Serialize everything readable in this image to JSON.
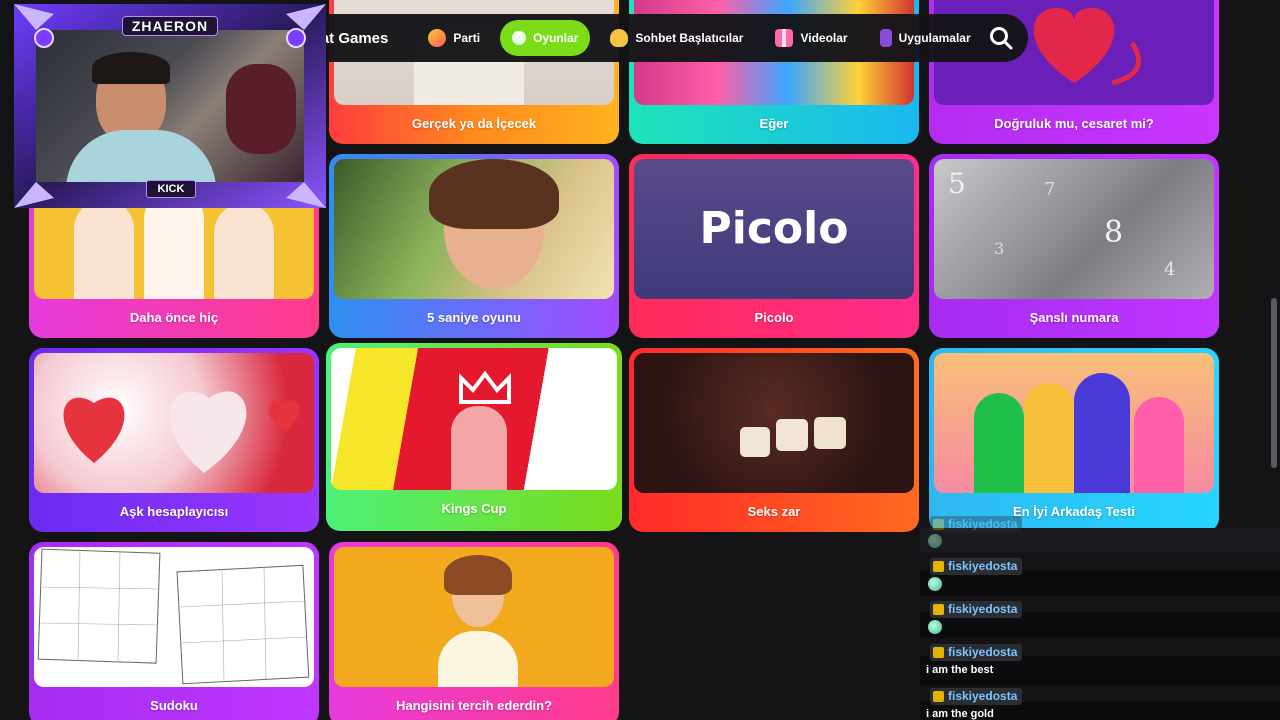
{
  "nav": {
    "brand": "Cat Games",
    "items": [
      {
        "label": "Parti",
        "icon": "party-mask-icon"
      },
      {
        "label": "Oyunlar",
        "icon": "joystick-icon",
        "active": true
      },
      {
        "label": "Sohbet Başlatıcılar",
        "icon": "waving-hand-icon"
      },
      {
        "label": "Videolar",
        "icon": "gift-icon"
      },
      {
        "label": "Uygulamalar",
        "icon": "apps-icon"
      }
    ],
    "search_icon": "search-icon"
  },
  "games": [
    {
      "title": "Gerçek ya da İçecek"
    },
    {
      "title": "Eğer"
    },
    {
      "title": "Doğruluk mu, cesaret mi?"
    },
    {
      "title": "Daha önce hiç"
    },
    {
      "title": "5 saniye oyunu"
    },
    {
      "title": "Picolo",
      "overlay_text": "Picolo"
    },
    {
      "title": "Şanslı numara"
    },
    {
      "title": "Aşk hesaplayıcısı"
    },
    {
      "title": "Kings Cup"
    },
    {
      "title": "Seks zar"
    },
    {
      "title": "En İyi Arkadaş Testi"
    },
    {
      "title": "Sudoku"
    },
    {
      "title": "Hangisini tercih ederdin?"
    }
  ],
  "streamer": {
    "name": "ZHAERON",
    "platform": "KICK"
  },
  "chat": {
    "messages": [
      {
        "user": "fiskiyedosta",
        "text": ""
      },
      {
        "user": "fiskiyedosta",
        "text": ""
      },
      {
        "user": "fiskiyedosta",
        "text": ""
      },
      {
        "user": "fiskiyedosta",
        "text": "i am the best"
      },
      {
        "user": "fiskiyedosta",
        "text": "i am the gold"
      }
    ]
  },
  "colors": {
    "background": "#141417",
    "active_nav": "#7bdc1a",
    "chat_username": "#7ec3ff"
  }
}
